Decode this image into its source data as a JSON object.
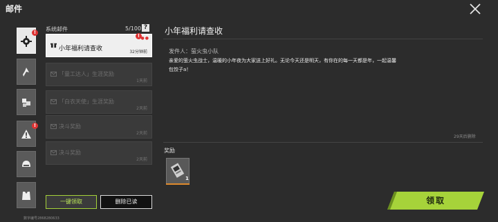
{
  "header": {
    "title": "邮件"
  },
  "categories": [
    {
      "id": "system",
      "active": true,
      "badge": "!"
    },
    {
      "id": "cat2",
      "active": false,
      "badge": ""
    },
    {
      "id": "cat3",
      "active": false,
      "badge": ""
    },
    {
      "id": "cat4",
      "active": false,
      "badge": "!"
    },
    {
      "id": "cat5",
      "active": false,
      "badge": ""
    },
    {
      "id": "cat6",
      "active": false,
      "badge": ""
    }
  ],
  "list": {
    "label": "系统邮件",
    "count": "5/100",
    "help": "?",
    "mails": [
      {
        "title": "小年福利请查收",
        "time": "32分钟前",
        "active": true,
        "badge": "!"
      },
      {
        "title": "「童工达人」生涯奖励",
        "time": "1天前",
        "active": false,
        "badge": ""
      },
      {
        "title": "「白衣天使」生涯奖励",
        "time": "2天前",
        "active": false,
        "badge": ""
      },
      {
        "title": "决斗奖励",
        "time": "2天前",
        "active": false,
        "badge": ""
      },
      {
        "title": "决斗奖励",
        "time": "2天前",
        "active": false,
        "badge": ""
      }
    ]
  },
  "buttons": {
    "claim_all": "一键领取",
    "delete_read": "删除已读",
    "claim": "领取"
  },
  "user": {
    "uid_text": "数字编号2868280633"
  },
  "detail": {
    "title": "小年福利请查收",
    "sender": "发件人：萤火虫小队",
    "body": "亲爱的萤火虫战士，温暖的小年夜为大家送上好礼。无论今天还是明天，有你在的每一天都是年，一起温馨包饺子a！",
    "expire": "29天后删除",
    "reward_label": "奖励",
    "reward_qty": "1"
  },
  "colors": {
    "accent_green": "#a6d33a",
    "badge_red": "#dd3333",
    "reward_orange": "#e08a2c"
  }
}
